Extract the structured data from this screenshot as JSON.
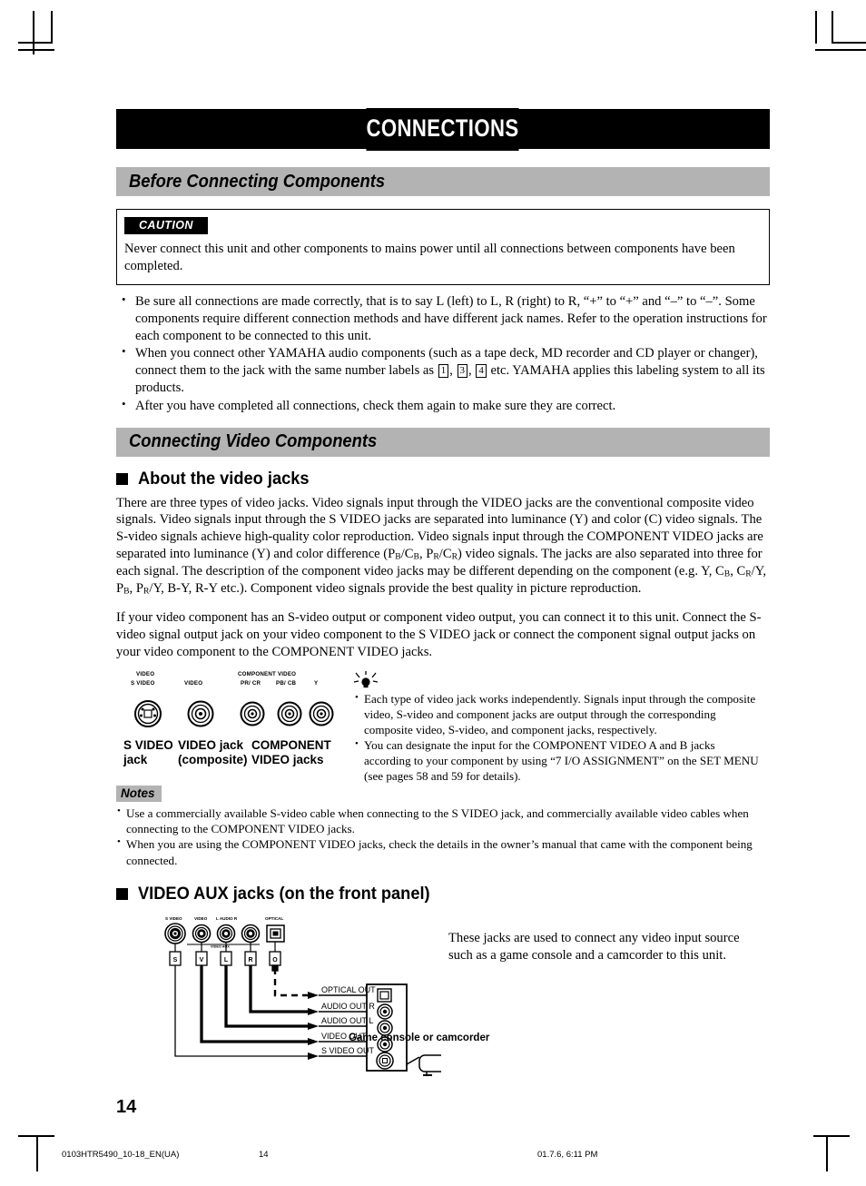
{
  "document": {
    "chapter_title": "CONNECTIONS",
    "page_number": "14"
  },
  "sections": {
    "before_connecting": {
      "heading": "Before Connecting Components",
      "caution": {
        "tag": "CAUTION",
        "text": "Never connect this unit and other components to mains power until all connections between components have been completed."
      },
      "bullets": [
        "Be sure all connections are made correctly, that is to say L (left) to L, R (right) to R, “+” to “+” and “–” to “–”. Some components require different connection methods and have different jack names. Refer to the operation instructions for each component to be connected to this unit.",
        "When you connect other YAMAHA audio components (such as a tape deck, MD recorder and CD player or changer), connect them to the jack with the same number labels as ▢, ▢, ▢ etc. YAMAHA applies this labeling system to all its products.",
        "After you have completed all connections, check them again to make sure they are correct."
      ],
      "bullet2_parts": {
        "pre": "When you connect other YAMAHA audio components (such as a tape deck, MD recorder and CD player or changer), connect them to the jack with the same number labels as ",
        "num1": "1",
        "sep1": ", ",
        "num2": "3",
        "sep2": ", ",
        "num3": "4",
        "post": " etc. YAMAHA applies this labeling system to all its products."
      }
    },
    "connecting_video": {
      "heading": "Connecting Video Components",
      "subhead_jacks": "About the video jacks",
      "para1_parts": {
        "a": "There are three types of video jacks. Video signals input through the VIDEO jacks are the conventional composite video signals. Video signals input through the S VIDEO jacks are separated into luminance (Y) and color (C) video signals. The S-video signals achieve high-quality color reproduction. Video signals input through the COMPONENT VIDEO jacks are separated into luminance (Y) and color difference (P",
        "sub1": "B",
        "b": "/C",
        "sub2": "B",
        "c": ", P",
        "sub3": "R",
        "d": "/C",
        "sub4": "R",
        "e": ") video signals. The jacks are also separated into three for each signal. The description of the component video jacks may be different depending on the component (e.g. Y, C",
        "sub5": "B",
        "f": ", C",
        "sub6": "R",
        "g": "/Y, P",
        "sub7": "B",
        "h": ", P",
        "sub8": "R",
        "i": "/Y, B-Y, R-Y etc.). Component video signals provide the best quality in picture reproduction."
      },
      "para2": "If your video component has an S-video output or component video output, you can connect it to this unit. Connect the S-video signal output jack on your video component to the S VIDEO jack or connect the component signal output jacks on your video component to the COMPONENT VIDEO jacks.",
      "jack_figure": {
        "panel_labels": {
          "video_top": "VIDEO",
          "s_video": "S VIDEO",
          "video": "VIDEO",
          "component_video": "COMPONENT VIDEO",
          "pr_cr": "PR/ CR",
          "pb_cb": "PB/ CB",
          "y": "Y"
        },
        "captions": {
          "s_video_jack_l1": "S VIDEO",
          "s_video_jack_l2": "jack",
          "video_jack_l1": "VIDEO jack",
          "video_jack_l2": "(composite)",
          "component_l1": "COMPONENT",
          "component_l2": "VIDEO jacks"
        }
      },
      "tips": [
        "Each type of video jack works independently. Signals input through the composite video, S-video and component jacks are output through the corresponding composite video, S-video, and component jacks, respectively.",
        "You can designate the input for the COMPONENT VIDEO A and B jacks according to your component by using “7 I/O ASSIGNMENT” on the SET MENU (see pages 58 and 59 for details)."
      ],
      "notes_tag": "Notes",
      "notes": [
        "Use a commercially available S-video cable when connecting to the S VIDEO jack, and commercially available video cables when connecting to the COMPONENT VIDEO jacks.",
        "When you are using the COMPONENT VIDEO jacks, check the details in the owner’s manual that came with the component being connected."
      ]
    },
    "video_aux": {
      "subhead": "VIDEO AUX jacks (on the front panel)",
      "description": "These jacks are used to connect any video input source such as a game console and a camcorder to this unit.",
      "panel_labels": {
        "s_video": "S VIDEO",
        "video": "VIDEO",
        "audio": "L  AUDIO  R",
        "optical": "OPTICAL",
        "video_aux": "VIDEO AUX"
      },
      "plug_letters": [
        "S",
        "V",
        "L",
        "R",
        "O"
      ],
      "connection_labels": [
        "OPTICAL OUT",
        "AUDIO OUT R",
        "AUDIO OUT L",
        "VIDEO OUT",
        "S VIDEO OUT"
      ],
      "device_label": "Game console or camcorder"
    }
  },
  "footer": {
    "file_name": "0103HTR5490_10-18_EN(UA)",
    "page": "14",
    "timestamp": "01.7.6, 6:11 PM"
  },
  "colors": {
    "chapter_bar": "#000000",
    "section_bar": "#b3b3b3",
    "notes_tag": "#b3b3b3",
    "text": "#000000",
    "page_bg": "#ffffff"
  }
}
